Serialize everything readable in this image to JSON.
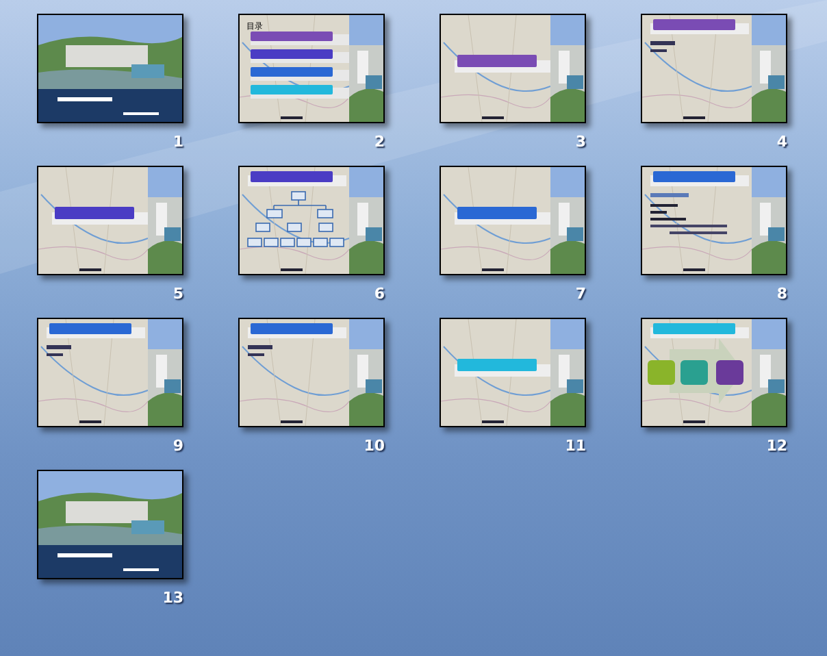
{
  "slides": [
    {
      "number": "1",
      "kind": "title"
    },
    {
      "number": "2",
      "kind": "agenda",
      "heading": "目录",
      "entries": [
        {
          "color": "#7a4cb4"
        },
        {
          "color": "#4a3cc4"
        },
        {
          "color": "#2a68d4"
        },
        {
          "color": "#22b8dc"
        }
      ]
    },
    {
      "number": "3",
      "kind": "section",
      "color": "#7a4cb4"
    },
    {
      "number": "4",
      "kind": "header-text",
      "color": "#7a4cb4"
    },
    {
      "number": "5",
      "kind": "section",
      "color": "#4a3cc4"
    },
    {
      "number": "6",
      "kind": "header-org",
      "color": "#4a3cc4"
    },
    {
      "number": "7",
      "kind": "section",
      "color": "#2a68d4"
    },
    {
      "number": "8",
      "kind": "header-list",
      "color": "#2a68d4"
    },
    {
      "number": "9",
      "kind": "header-text",
      "color": "#2a68d4"
    },
    {
      "number": "10",
      "kind": "header-text",
      "color": "#2a68d4"
    },
    {
      "number": "11",
      "kind": "section",
      "color": "#22b8dc"
    },
    {
      "number": "12",
      "kind": "header-steps",
      "color": "#22b8dc"
    },
    {
      "number": "13",
      "kind": "title"
    }
  ]
}
